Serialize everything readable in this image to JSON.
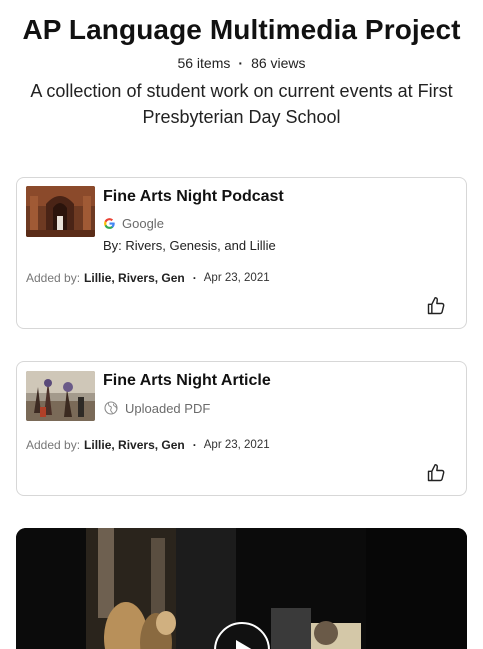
{
  "header": {
    "title": "AP Language Multimedia Project",
    "items": "56 items",
    "views": "86 views",
    "description": "A collection of student work on current events at First Presbyterian Day School"
  },
  "cards": [
    {
      "title": "Fine Arts Night Podcast",
      "source": "Google",
      "source_icon": "google-icon",
      "byline": "By: Rivers, Genesis, and Lillie",
      "added_by_label": "Added by:",
      "added_by_names": "Lillie, Rivers, Gen",
      "date": "Apr 23, 2021",
      "like_icon": "thumbs-up-icon"
    },
    {
      "title": "Fine Arts Night Article",
      "source": "Uploaded PDF",
      "source_icon": "globe-icon",
      "added_by_label": "Added by:",
      "added_by_names": "Lillie, Rivers, Gen",
      "date": "Apr 23, 2021",
      "like_icon": "thumbs-up-icon"
    }
  ],
  "video": {
    "play_icon": "play-icon"
  },
  "colors": {
    "card_border": "#d7d7d7",
    "muted_text": "#6b6b6b",
    "video_bg": "#0b0b0b"
  }
}
